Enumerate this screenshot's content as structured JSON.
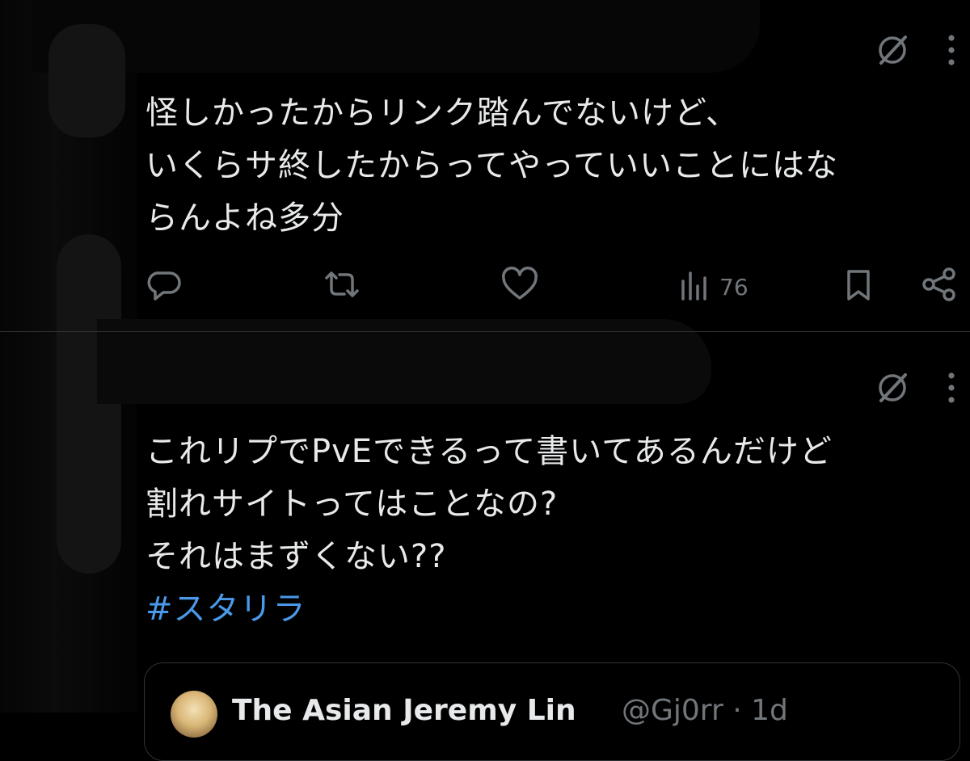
{
  "tweets": [
    {
      "lines": [
        "怪しかったからリンク踏んでないけど、",
        "いくらサ終したからってやっていいことにはな",
        "らんよね多分"
      ],
      "actions": {
        "reply_icon": "reply-icon",
        "repost_icon": "repost-icon",
        "like_icon": "heart-icon",
        "views_icon": "views-icon",
        "views_count": "76",
        "bookmark_icon": "bookmark-icon",
        "share_icon": "share-icon"
      }
    },
    {
      "lines": [
        "これリプでPvEできるって書いてあるんだけど",
        "割れサイトってはことなの?",
        "それはまずくない??"
      ],
      "hashtag": "#スタリラ"
    }
  ],
  "quote": {
    "name": "The Asian Jeremy Lin",
    "handle": "@Gj0rr",
    "time": "· 1d"
  },
  "colors": {
    "background": "#000000",
    "text": "#e7e9ea",
    "muted": "#71767b",
    "link": "#4a99e9",
    "divider": "#2f3336"
  }
}
